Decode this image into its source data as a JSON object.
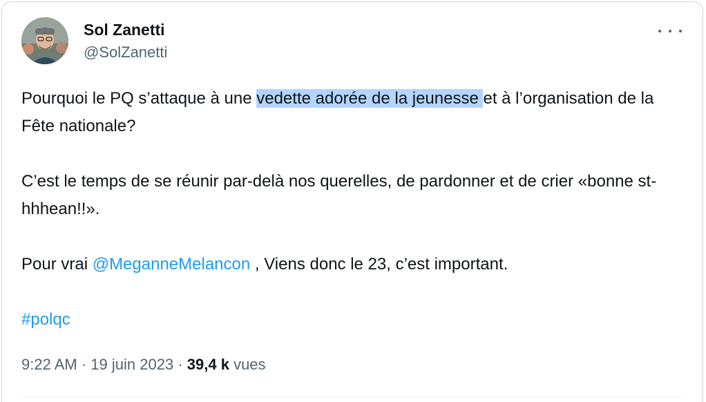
{
  "author": {
    "display_name": "Sol Zanetti",
    "handle": "@SolZanetti",
    "more_icon": "more-horizontal-icon"
  },
  "tweet": {
    "p1_before": "Pourquoi le PQ s’attaque à une ",
    "p1_highlight": "vedette adorée de la jeunesse ",
    "p1_after": "et à l’organisation de la Fête nationale?",
    "p2": "C’est le temps de se réunir par-delà nos querelles, de pardonner et de crier «bonne st-hhhean!!».",
    "p3_before": "Pour vrai ",
    "p3_mention": "@MeganneMelancon",
    "p3_after": " , Viens donc le 23, c’est important.",
    "hashtag": "#polqc"
  },
  "meta": {
    "time": "9:22 AM",
    "separator": "·",
    "date": "19 juin 2023",
    "views_count": "39,4 k",
    "views_label": "vues"
  },
  "colors": {
    "link": "#1d9bf0",
    "highlight": "#b3d4fd",
    "secondary_text": "#536471",
    "border": "#cfd9de"
  }
}
